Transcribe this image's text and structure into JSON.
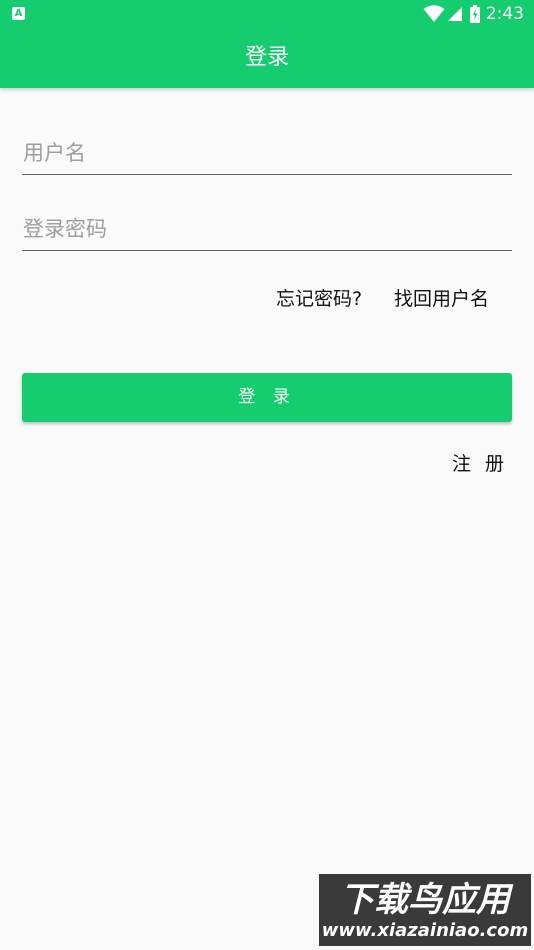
{
  "status_bar": {
    "left_icon": "A",
    "time": "2:43",
    "icons": [
      "wifi-icon",
      "signal-icon",
      "battery-icon"
    ]
  },
  "app_bar": {
    "title": "登录",
    "color": "#15cd6e"
  },
  "form": {
    "username_placeholder": "用户名",
    "username_value": "",
    "password_placeholder": "登录密码",
    "password_value": "",
    "forgot_password_label": "忘记密码?",
    "find_username_label": "找回用户名",
    "login_button_label": "登 录",
    "register_label": "注 册"
  },
  "watermark": {
    "line1": "下载鸟应用",
    "line2": "www.xiazainiao.com"
  }
}
